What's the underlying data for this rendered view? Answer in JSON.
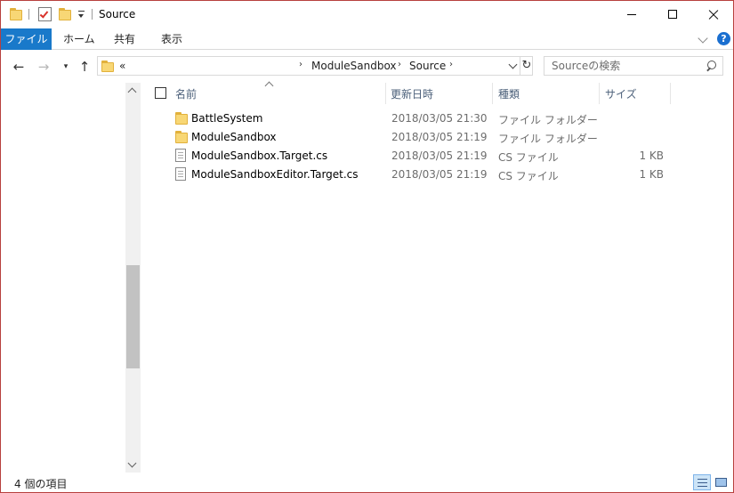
{
  "window": {
    "title": "Source"
  },
  "ribbon": {
    "tabs": [
      {
        "label": "ファイル",
        "active": true
      },
      {
        "label": "ホーム"
      },
      {
        "label": "共有"
      },
      {
        "label": "表示"
      }
    ],
    "help_label": "?"
  },
  "address": {
    "overflow": "«",
    "crumbs": [
      "ModuleSandbox",
      "Source"
    ],
    "separator": "›"
  },
  "search": {
    "placeholder": "Sourceの検索"
  },
  "columns": {
    "name": "名前",
    "date": "更新日時",
    "type": "種類",
    "size": "サイズ"
  },
  "files": [
    {
      "name": "BattleSystem",
      "date": "2018/03/05 21:30",
      "type": "ファイル フォルダー",
      "size": "",
      "icon": "folder-icon"
    },
    {
      "name": "ModuleSandbox",
      "date": "2018/03/05 21:19",
      "type": "ファイル フォルダー",
      "size": "",
      "icon": "folder-icon"
    },
    {
      "name": "ModuleSandbox.Target.cs",
      "date": "2018/03/05 21:19",
      "type": "CS ファイル",
      "size": "1 KB",
      "icon": "document-icon"
    },
    {
      "name": "ModuleSandboxEditor.Target.cs",
      "date": "2018/03/05 21:19",
      "type": "CS ファイル",
      "size": "1 KB",
      "icon": "document-icon"
    }
  ],
  "status": {
    "item_count": "4 個の項目"
  },
  "colors": {
    "file_tab": "#1979ca",
    "window_border": "#b7403e",
    "folder": "#f8d775",
    "header_text": "#4c607a"
  }
}
